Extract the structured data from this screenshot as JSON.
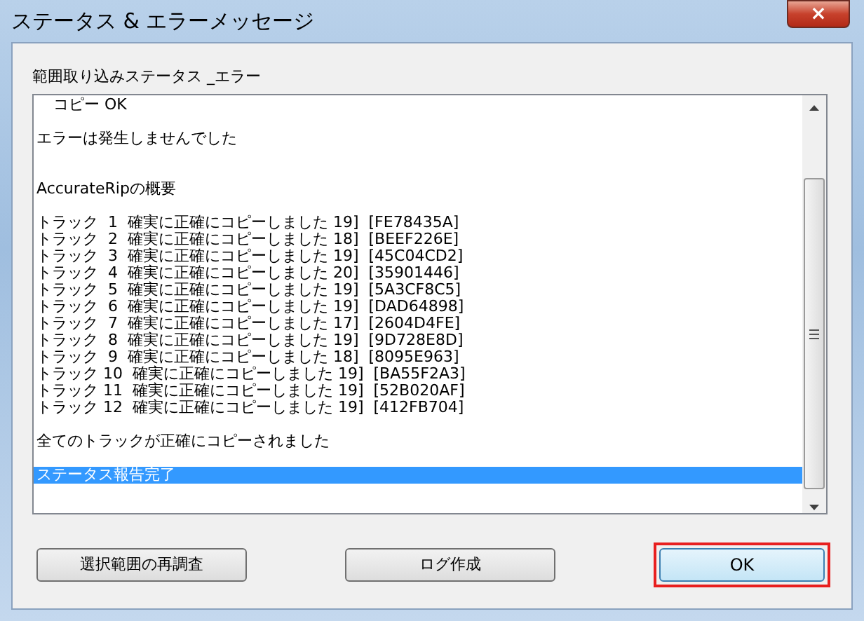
{
  "window": {
    "title": "ステータス & エラーメッセージ",
    "close": "×"
  },
  "group_label": "範囲取り込みステータス _エラー",
  "log": [
    {
      "kind": "line",
      "indent": true,
      "lines": [
        {
          "text": "コピー OK",
          "selected": false
        }
      ]
    },
    {
      "kind": "line",
      "indent": false,
      "lines": [
        {
          "text": "エラーは発生しませんでした",
          "selected": false
        }
      ]
    },
    {
      "kind": "section",
      "indent": false,
      "lines": [
        {
          "text": "AccurateRipの概要",
          "selected": false
        }
      ]
    },
    {
      "kind": "line",
      "indent": false,
      "lines": [
        {
          "text": "トラック  1  確実に正確にコピーしました 19]  [FE78435A]",
          "selected": false
        },
        {
          "text": "トラック  2  確実に正確にコピーしました 18]  [BEEF226E]",
          "selected": false
        },
        {
          "text": "トラック  3  確実に正確にコピーしました 19]  [45C04CD2]",
          "selected": false
        },
        {
          "text": "トラック  4  確実に正確にコピーしました 20]  [35901446]",
          "selected": false
        },
        {
          "text": "トラック  5  確実に正確にコピーしました 19]  [5A3CF8C5]",
          "selected": false
        },
        {
          "text": "トラック  6  確実に正確にコピーしました 19]  [DAD64898]",
          "selected": false
        },
        {
          "text": "トラック  7  確実に正確にコピーしました 17]  [2604D4FE]",
          "selected": false
        },
        {
          "text": "トラック  8  確実に正確にコピーしました 19]  [9D728E8D]",
          "selected": false
        },
        {
          "text": "トラック  9  確実に正確にコピーしました 18]  [8095E963]",
          "selected": false
        },
        {
          "text": "トラック 10  確実に正確にコピーしました 19]  [BA55F2A3]",
          "selected": false
        },
        {
          "text": "トラック 11  確実に正確にコピーしました 19]  [52B020AF]",
          "selected": false
        },
        {
          "text": "トラック 12  確実に正確にコピーしました 19]  [412FB704]",
          "selected": false
        }
      ]
    },
    {
      "kind": "line",
      "indent": false,
      "lines": [
        {
          "text": "全てのトラックが正確にコピーされました",
          "selected": false
        }
      ]
    },
    {
      "kind": "line",
      "indent": false,
      "lines": [
        {
          "text": "ステータス報告完了",
          "selected": true
        }
      ]
    }
  ],
  "buttons": [
    {
      "label": "選択範囲の再調査",
      "default": false
    },
    {
      "label": "ログ作成",
      "default": false
    },
    {
      "label": "OK",
      "default": true
    }
  ]
}
